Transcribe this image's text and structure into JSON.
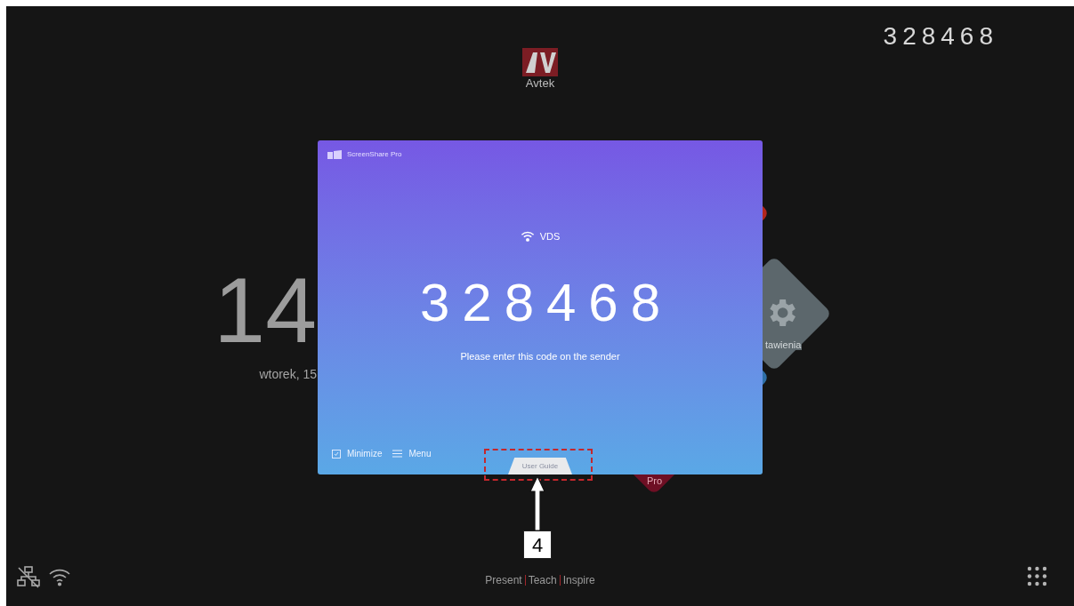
{
  "top_code": "328468",
  "logo": {
    "text": "Avtek"
  },
  "clock": {
    "time": "14",
    "date": "wtorek, 15"
  },
  "tiles": [
    {
      "kind": "plain",
      "color": "#b3261e"
    },
    {
      "kind": "settings",
      "label": "tawienia",
      "color": "#5c676c"
    },
    {
      "kind": "plain",
      "color": "#2f6fa8"
    },
    {
      "kind": "app",
      "label": "Pro",
      "color": "#6e0f24"
    }
  ],
  "dialog": {
    "title": "ScreenShare Pro",
    "network": "VDS",
    "code": "328468",
    "instruction": "Please enter this code on the sender",
    "buttons": [
      {
        "kind": "minimize",
        "label": "Minimize"
      },
      {
        "kind": "menu",
        "label": "Menu"
      }
    ],
    "guide_tab": "User Guide"
  },
  "annotation": {
    "label": "4"
  },
  "footer": {
    "slogan": [
      "Present",
      "Teach",
      "Inspire"
    ]
  }
}
